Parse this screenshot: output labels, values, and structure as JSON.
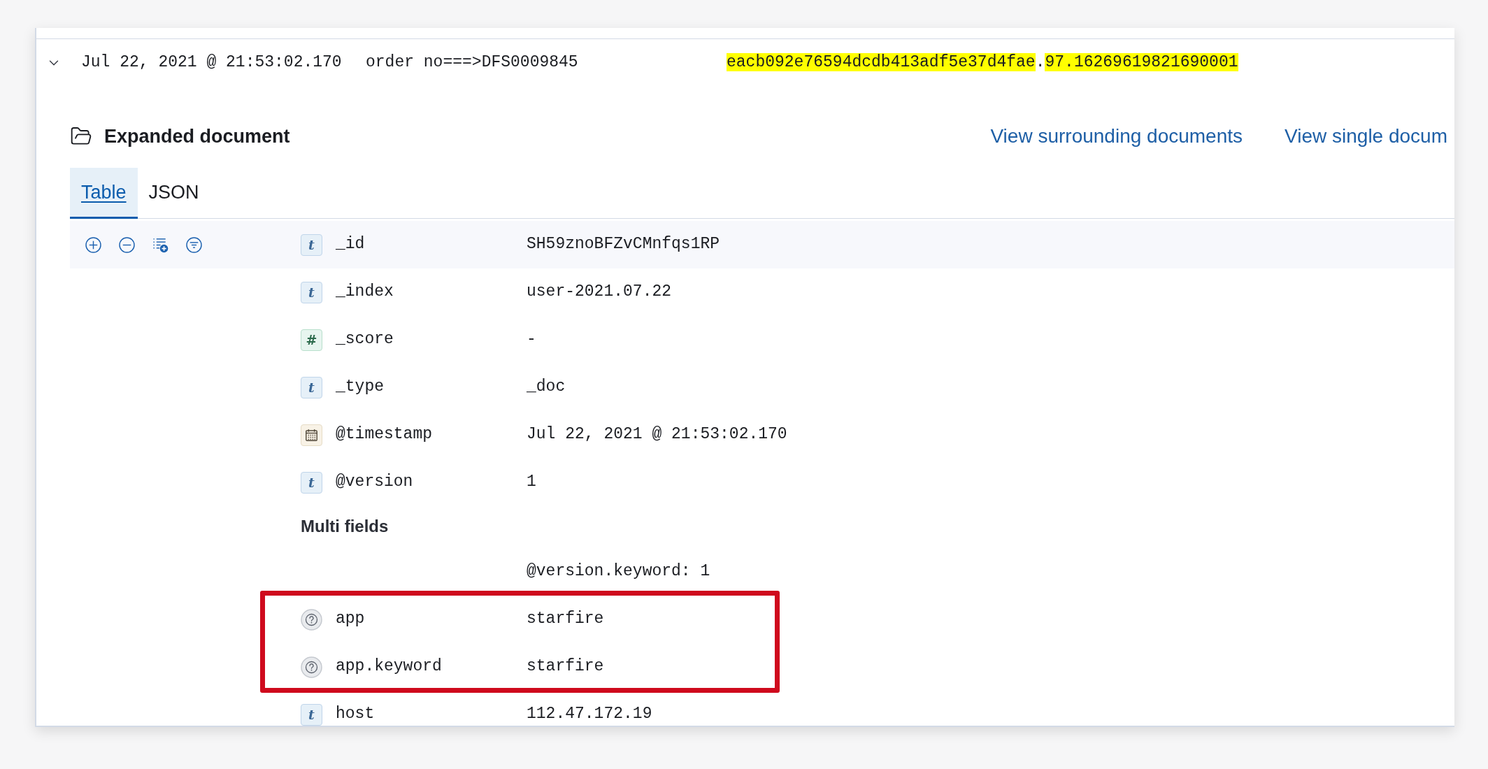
{
  "document_row": {
    "expanded": true,
    "cells": [
      {
        "segments": [
          {
            "text": "Jul 22, 2021 @ 21:53:02.170",
            "highlighted": false
          }
        ]
      },
      {
        "segments": [
          {
            "text": "order no===>DFS0009845",
            "highlighted": false
          }
        ]
      },
      {
        "segments": [
          {
            "text": "eacb092e76594dcdb413adf5e37d4fae",
            "highlighted": true
          },
          {
            "text": ".",
            "highlighted": false
          },
          {
            "text": "97.16269619821690001",
            "highlighted": true
          }
        ]
      }
    ]
  },
  "expanded_document": {
    "title": "Expanded document",
    "links": [
      "View surrounding documents",
      "View single docum"
    ],
    "tabs": [
      {
        "label": "Table",
        "selected": true
      },
      {
        "label": "JSON",
        "selected": false
      }
    ],
    "fields": [
      {
        "kind": "string",
        "glyph": "t",
        "name": "_id",
        "value": "SH59znoBFZvCMnfqs1RP",
        "hovered": true,
        "annotated": false
      },
      {
        "kind": "string",
        "glyph": "t",
        "name": "_index",
        "value": "user-2021.07.22",
        "hovered": false,
        "annotated": false
      },
      {
        "kind": "number",
        "glyph": "#",
        "name": "_score",
        "value": "-",
        "hovered": false,
        "annotated": false
      },
      {
        "kind": "string",
        "glyph": "t",
        "name": "_type",
        "value": "_doc",
        "hovered": false,
        "annotated": false
      },
      {
        "kind": "date",
        "name": "@timestamp",
        "value": "Jul 22, 2021 @ 21:53:02.170",
        "hovered": false,
        "annotated": false
      },
      {
        "kind": "string",
        "glyph": "t",
        "name": "@version",
        "value": "1",
        "hovered": false,
        "annotated": false,
        "multi_fields": {
          "heading": "Multi fields",
          "values": [
            "@version.keyword: 1"
          ]
        }
      },
      {
        "kind": "unknown",
        "name": "app",
        "value": "starfire",
        "hovered": false,
        "annotated": true
      },
      {
        "kind": "unknown",
        "name": "app.keyword",
        "value": "starfire",
        "hovered": false,
        "annotated": true
      },
      {
        "kind": "string",
        "glyph": "t",
        "name": "host",
        "value": "112.47.172.19",
        "hovered": false,
        "annotated": false
      }
    ]
  }
}
